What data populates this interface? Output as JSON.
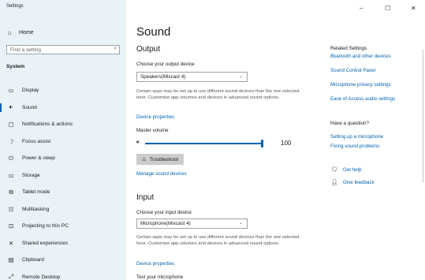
{
  "window": {
    "title": "Settings",
    "minimize_glyph": "–",
    "maximize_glyph": "☐",
    "close_glyph": "✕"
  },
  "sidebar": {
    "home": {
      "label": "Home",
      "icon": "home-icon",
      "glyph": "⌂"
    },
    "search": {
      "placeholder": "Find a setting",
      "value": "",
      "icon": "search-icon",
      "glyph": "⌕"
    },
    "section": "System",
    "items": [
      {
        "label": "Display",
        "icon": "display-icon",
        "glyph": "▭",
        "active": false
      },
      {
        "label": "Sound",
        "icon": "speaker-icon",
        "glyph": "🔉︎",
        "active": true
      },
      {
        "label": "Notifications & actions",
        "icon": "notifications-icon",
        "glyph": "▢",
        "active": false
      },
      {
        "label": "Focus assist",
        "icon": "moon-icon",
        "glyph": "☽",
        "active": false
      },
      {
        "label": "Power & sleep",
        "icon": "power-icon",
        "glyph": "⏻",
        "active": false
      },
      {
        "label": "Storage",
        "icon": "storage-icon",
        "glyph": "▭",
        "active": false
      },
      {
        "label": "Tablet mode",
        "icon": "tablet-mode-icon",
        "glyph": "⧉",
        "active": false
      },
      {
        "label": "Multitasking",
        "icon": "multitasking-icon",
        "glyph": "☷",
        "active": false
      },
      {
        "label": "Projecting to this PC",
        "icon": "projector-icon",
        "glyph": "⊡",
        "active": false
      },
      {
        "label": "Shared experiences",
        "icon": "shared-experiences-icon",
        "glyph": "✕",
        "active": false
      },
      {
        "label": "Clipboard",
        "icon": "clipboard-icon",
        "glyph": "▤",
        "active": false
      },
      {
        "label": "Remote Desktop",
        "icon": "remote-desktop-icon",
        "glyph": "⤢",
        "active": false
      }
    ]
  },
  "main": {
    "title": "Sound",
    "output": {
      "heading": "Output",
      "device_label": "Choose your output device",
      "device_value": "Speakers(Mixcast 4)",
      "description": "Certain apps may be set up to use different sound devices than the one selected here. Customize app volumes and devices in advanced sound options.",
      "device_properties": "Device properties",
      "volume_label": "Master volume",
      "volume_icon": "volume-icon",
      "volume_glyph": "🔉︎",
      "volume_value": "100",
      "volume_fraction": 1.0,
      "troubleshoot_label": "Troubleshoot",
      "troubleshoot_icon": "warning-icon",
      "troubleshoot_glyph": "⚠",
      "manage_devices": "Manage sound devices"
    },
    "input": {
      "heading": "Input",
      "device_label": "Choose your input device",
      "device_value": "Microphone(Mixcast 4)",
      "description": "Certain apps may be set up to use different sound devices than the one selected here. Customize app volumes and devices in advanced sound options.",
      "device_properties": "Device properties",
      "test_label": "Test your microphone"
    },
    "chevron_glyph": "⌄"
  },
  "related": {
    "heading": "Related Settings",
    "links": [
      "Bluetooth and other devices",
      "Sound Control Panel",
      "Microphone privacy settings",
      "Ease of Access audio settings"
    ],
    "question_heading": "Have a question?",
    "question_links": [
      "Setting up a microphone",
      "Fixing sound problems"
    ],
    "help": {
      "label": "Get help",
      "icon": "help-icon",
      "glyph": "🗨︎"
    },
    "feedback": {
      "label": "Give feedback",
      "icon": "feedback-icon",
      "glyph": "👤︎"
    }
  },
  "colors": {
    "accent": "#0063b1",
    "sidebar_bg": "#e9f2f6",
    "button_bg": "#cccccc"
  }
}
